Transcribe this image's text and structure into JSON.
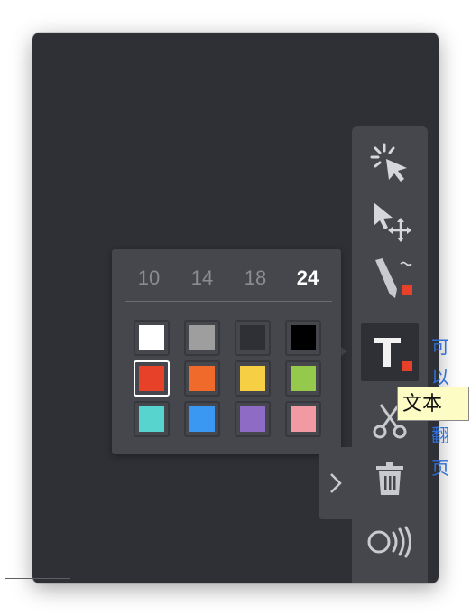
{
  "colors": {
    "canvas": "#2e3036",
    "toolbar": "#45474c",
    "accent_red": "#e8412a",
    "link_blue": "#2f6fd6"
  },
  "side_text": [
    "可",
    "以",
    "翻",
    "页"
  ],
  "toolbar": {
    "tools": [
      {
        "name": "laser-pointer",
        "icon": "laser-pointer-icon"
      },
      {
        "name": "select-move",
        "icon": "select-move-icon"
      },
      {
        "name": "pen",
        "icon": "pen-icon",
        "color": "#e8412a"
      },
      {
        "name": "text",
        "icon": "text-icon",
        "color": "#e8412a",
        "active": true
      },
      {
        "name": "cut",
        "icon": "scissors-icon"
      },
      {
        "name": "delete",
        "icon": "trash-icon"
      },
      {
        "name": "audio",
        "icon": "audio-icon"
      }
    ],
    "tooltip": "文本"
  },
  "text_options": {
    "font_sizes": [
      "10",
      "14",
      "18",
      "24"
    ],
    "selected_size": "24",
    "swatches": [
      "#ffffff",
      "#9e9e9e",
      "#2e3036",
      "#000000",
      "#e8412a",
      "#ef6a2b",
      "#f7cf45",
      "#95c94b",
      "#57d4ce",
      "#3a97f2",
      "#8e6cc6",
      "#f29aa3"
    ],
    "selected_color": "#e8412a"
  },
  "expand_tab": {
    "icon": "chevron-right-icon"
  }
}
